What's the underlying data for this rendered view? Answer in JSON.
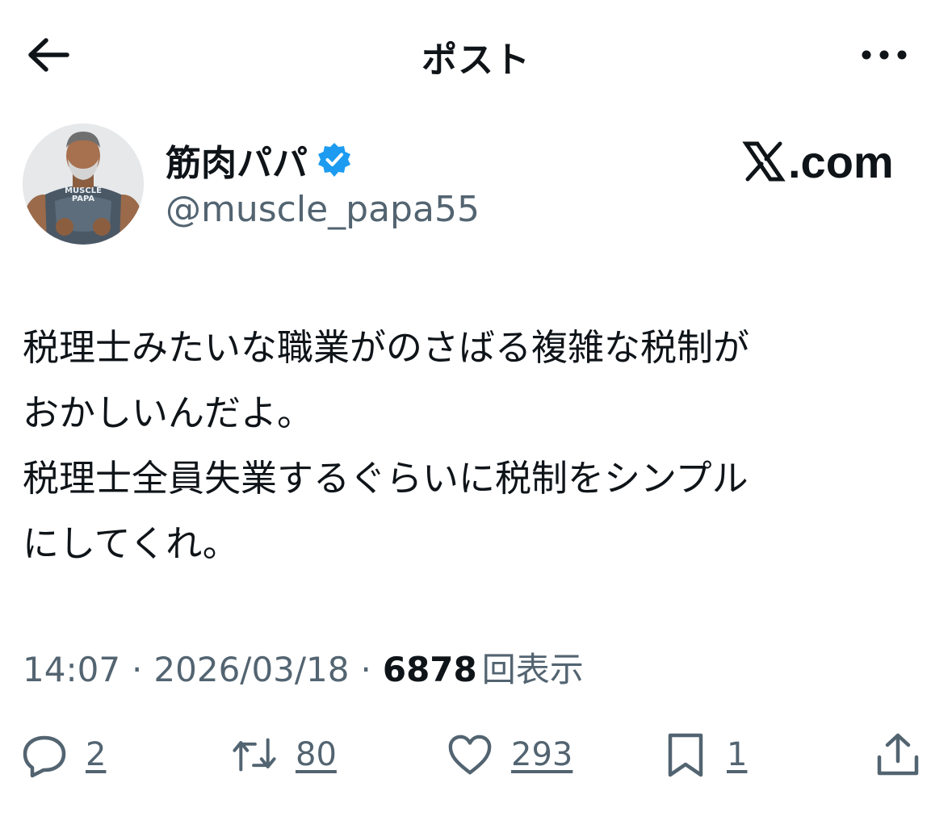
{
  "header": {
    "title": "ポスト",
    "back_icon": "arrow-left-icon",
    "more_icon": "more-horizontal-icon"
  },
  "author": {
    "display_name": "筋肉パパ",
    "handle": "@muscle_papa55",
    "verified": true,
    "verified_color": "#1d9bf0",
    "avatar_shirt_text": "MUSCLE PAPA"
  },
  "watermark": {
    "text": ".com"
  },
  "tweet": {
    "text": "税理士みたいな職業がのさばる複雑な税制が\nおかしいんだよ。\n税理士全員失業するぐらいに税制をシンプル\nにしてくれ。"
  },
  "meta": {
    "time": "14:07",
    "separator": "·",
    "date": "2026/03/18",
    "views_count": "6878",
    "views_label": "回表示"
  },
  "actions": {
    "reply": {
      "count": "2",
      "icon": "reply-icon"
    },
    "retweet": {
      "count": "80",
      "icon": "retweet-icon"
    },
    "like": {
      "count": "293",
      "icon": "heart-icon"
    },
    "bookmark": {
      "count": "1",
      "icon": "bookmark-icon"
    },
    "share": {
      "icon": "share-icon"
    }
  },
  "colors": {
    "text": "#0f1419",
    "secondary": "#536471",
    "accent": "#1d9bf0"
  }
}
